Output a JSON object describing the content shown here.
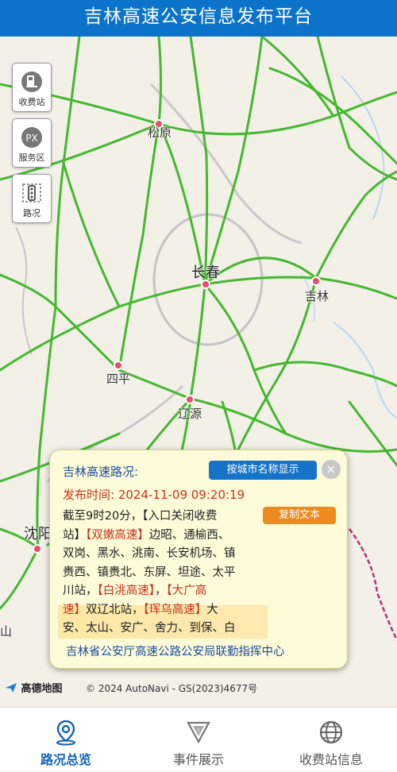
{
  "header": {
    "title": "吉林高速公安信息发布平台"
  },
  "map": {
    "side_buttons": [
      {
        "label": "收费站",
        "icon": "toll-station-icon"
      },
      {
        "label": "服务区",
        "icon": "service-area-icon",
        "badge": "PX"
      },
      {
        "label": "路况",
        "icon": "traffic-icon"
      }
    ],
    "cities": {
      "songyuan": "松原",
      "changchun": "长春",
      "jilin": "吉林",
      "siping": "四平",
      "liaoyuan": "辽源",
      "shenyang": "沈阳",
      "shan": "山"
    },
    "attribution": {
      "logo": "高德地图",
      "copyright": "© 2024 AutoNavi - GS(2023)4677号"
    }
  },
  "popup": {
    "title": "吉林高速路况:",
    "city_button": "按城市名称显示",
    "close": "×",
    "publish_time": "发布时间: 2024-11-09 09:20:19",
    "copy_button": "复制文本",
    "body": {
      "line1": "截至9时20分，【入口关闭收费",
      "p1": "站】",
      "road1": "【双嫩高速】",
      "p2": "边昭、通榆西、",
      "line3": "双岗、黑水、洮南、长安机场、镇",
      "line4": "赉西、镇赉北、东屏、坦途、太平",
      "p3": "川站，",
      "road2": "【白洮高速】",
      "p4": "，",
      "road3": "【大广高",
      "road3b": "速】",
      "p5": "双辽北站，",
      "road4": "【珲乌高速】",
      "p6": "大",
      "line7": "安、太山、安广、舍力、到保、白"
    },
    "footer": "吉林省公安厅高速公路公安局联勤指挥中心"
  },
  "tabs": [
    {
      "label": "路况总览",
      "icon": "location-pin-icon",
      "active": true
    },
    {
      "label": "事件展示",
      "icon": "warning-triangle-icon",
      "active": false
    },
    {
      "label": "收费站信息",
      "icon": "globe-icon",
      "active": false
    }
  ],
  "colors": {
    "header": "#0b73c9",
    "highway": "#44b82e",
    "alert": "#c8321e",
    "popup_bg": "#fefbd9"
  }
}
